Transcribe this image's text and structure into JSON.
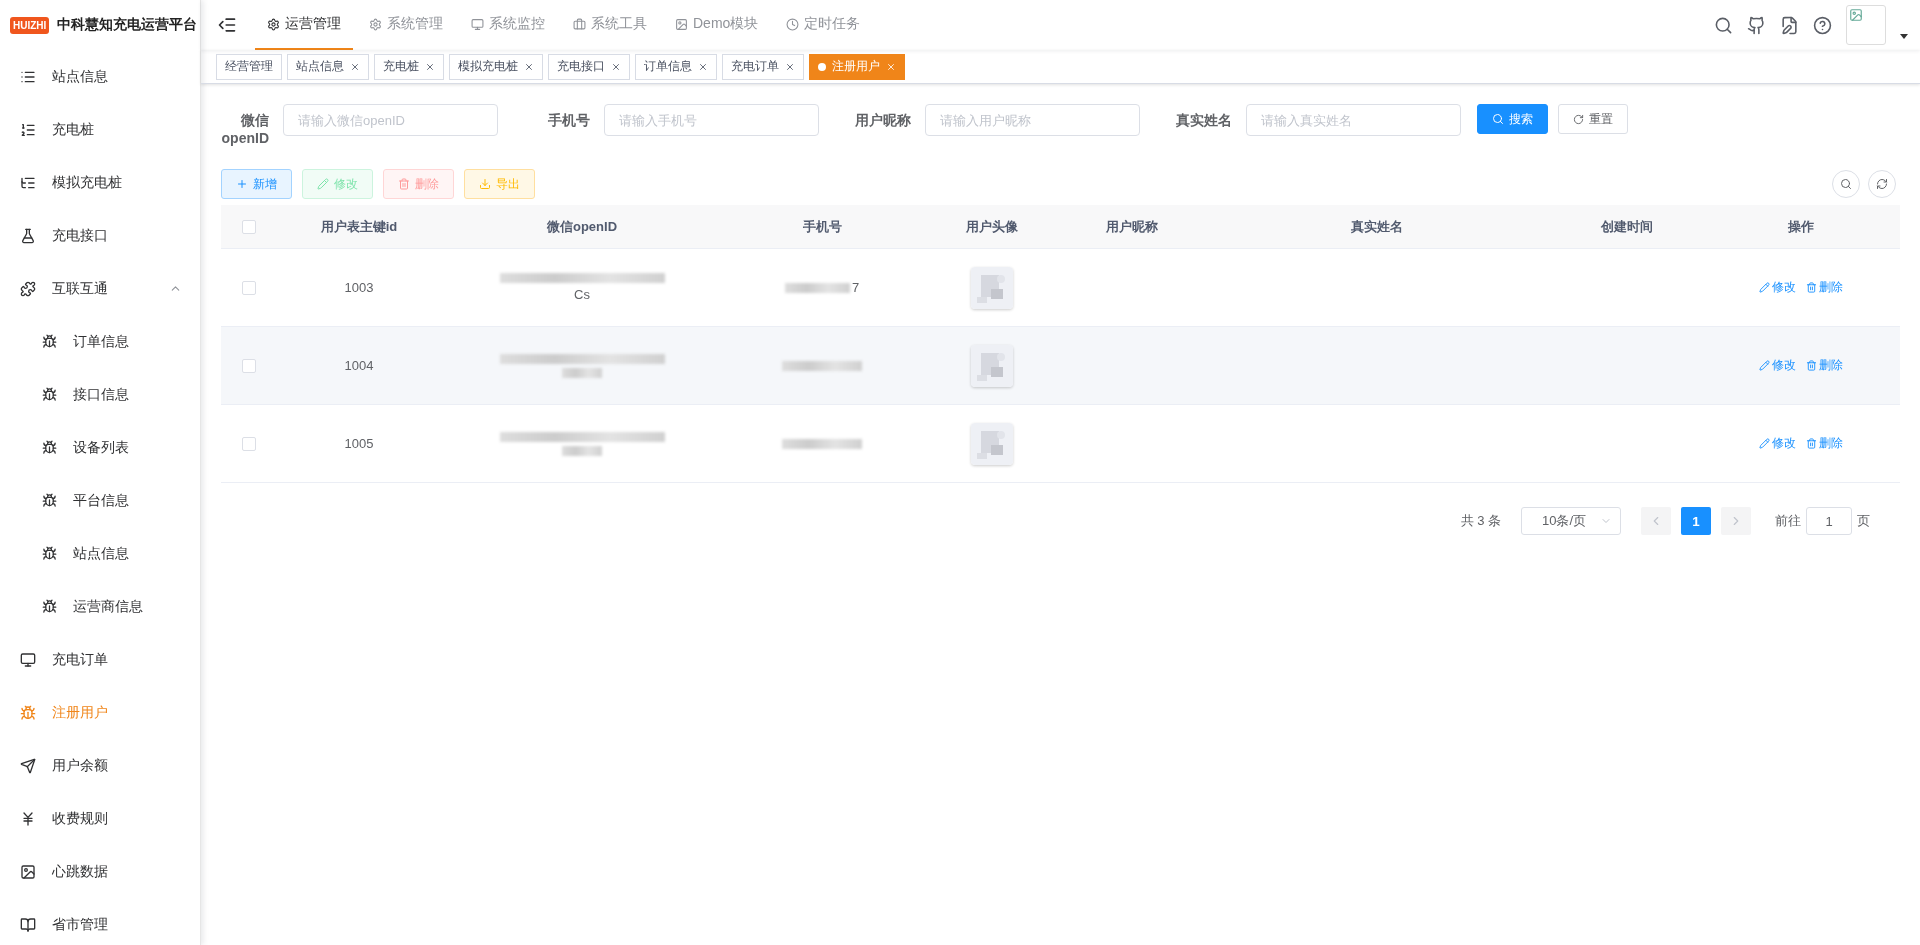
{
  "brand": {
    "logo": "HUIZHI",
    "title": "中科慧知充电运营平台"
  },
  "sidebar": {
    "items": [
      {
        "label": "站点信息",
        "selected": false
      },
      {
        "label": "充电桩",
        "selected": false
      },
      {
        "label": "模拟充电桩",
        "selected": false
      },
      {
        "label": "充电接口",
        "selected": false
      },
      {
        "label": "互联互通",
        "selected": false,
        "expanded": true,
        "children": [
          {
            "label": "订单信息",
            "selected": false
          },
          {
            "label": "接口信息",
            "selected": false
          },
          {
            "label": "设备列表",
            "selected": false
          },
          {
            "label": "平台信息",
            "selected": false
          },
          {
            "label": "站点信息",
            "selected": false
          },
          {
            "label": "运营商信息",
            "selected": false
          }
        ]
      },
      {
        "label": "充电订单",
        "selected": false
      },
      {
        "label": "注册用户",
        "selected": true
      },
      {
        "label": "用户余额",
        "selected": false
      },
      {
        "label": "收费规则",
        "selected": false
      },
      {
        "label": "心跳数据",
        "selected": false
      },
      {
        "label": "省市管理",
        "selected": false
      }
    ]
  },
  "top_nav": [
    {
      "label": "运营管理",
      "selected": true
    },
    {
      "label": "系统管理",
      "selected": false
    },
    {
      "label": "系统监控",
      "selected": false
    },
    {
      "label": "系统工具",
      "selected": false
    },
    {
      "label": "Demo模块",
      "selected": false
    },
    {
      "label": "定时任务",
      "selected": false
    }
  ],
  "tags": [
    {
      "label": "经营管理",
      "selected": false,
      "closable": false
    },
    {
      "label": "站点信息",
      "selected": false,
      "closable": true
    },
    {
      "label": "充电桩",
      "selected": false,
      "closable": true
    },
    {
      "label": "模拟充电桩",
      "selected": false,
      "closable": true
    },
    {
      "label": "充电接口",
      "selected": false,
      "closable": true
    },
    {
      "label": "订单信息",
      "selected": false,
      "closable": true
    },
    {
      "label": "充电订单",
      "selected": false,
      "closable": true
    },
    {
      "label": "注册用户",
      "selected": true,
      "closable": true
    }
  ],
  "search_form": {
    "fields": [
      {
        "label": "微信openID",
        "placeholder": "请输入微信openID"
      },
      {
        "label": "手机号",
        "placeholder": "请输入手机号"
      },
      {
        "label": "用户昵称",
        "placeholder": "请输入用户昵称"
      },
      {
        "label": "真实姓名",
        "placeholder": "请输入真实姓名"
      }
    ],
    "search_button": "搜索",
    "reset_button": "重置"
  },
  "toolbar": [
    {
      "label": "新增",
      "kind": "primary",
      "disabled": false
    },
    {
      "label": "修改",
      "kind": "success",
      "disabled": true
    },
    {
      "label": "删除",
      "kind": "danger",
      "disabled": true
    },
    {
      "label": "导出",
      "kind": "warning",
      "disabled": false
    }
  ],
  "table": {
    "header_checked": false,
    "columns": [
      "用户表主键id",
      "微信openID",
      "手机号",
      "用户头像",
      "用户昵称",
      "真实姓名",
      "创建时间",
      "操作"
    ],
    "rows": [
      {
        "checked": false,
        "id": "1003",
        "openid": "Cs",
        "phone": "7",
        "edit": "修改",
        "delete": "删除"
      },
      {
        "checked": false,
        "id": "1004",
        "edit": "修改",
        "delete": "删除"
      },
      {
        "checked": false,
        "id": "1005",
        "edit": "修改",
        "delete": "删除"
      }
    ]
  },
  "pagination": {
    "total": "共 3 条",
    "page_size": "10条/页",
    "pages": [
      {
        "label": "1",
        "selected": true
      }
    ],
    "goto_label": "前往",
    "goto_value": "1",
    "page_suffix": "页"
  }
}
